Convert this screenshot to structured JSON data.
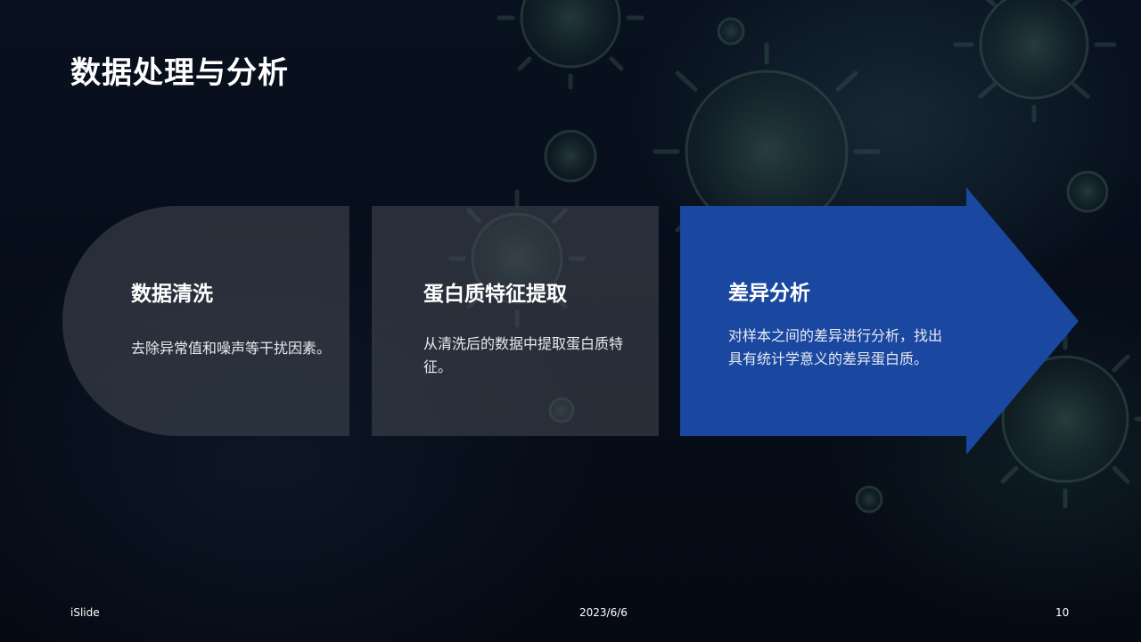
{
  "slide": {
    "title": "数据处理与分析",
    "steps": [
      {
        "title": "数据清洗",
        "description": "去除异常值和噪声等干扰因素。"
      },
      {
        "title": "蛋白质特征提取",
        "description": "从清洗后的数据中提取蛋白质特征。"
      },
      {
        "title": "差异分析",
        "description": "对样本之间的差异进行分析，找出具有统计学意义的差异蛋白质。"
      }
    ],
    "footer": {
      "brand": "iSlide",
      "date": "2023/6/6",
      "page_number": "10"
    }
  },
  "colors": {
    "background": "#050a14",
    "card": "#464a54",
    "accent": "#1a47a0",
    "text": "#ffffff"
  },
  "icons": [
    "virus-background-image"
  ]
}
